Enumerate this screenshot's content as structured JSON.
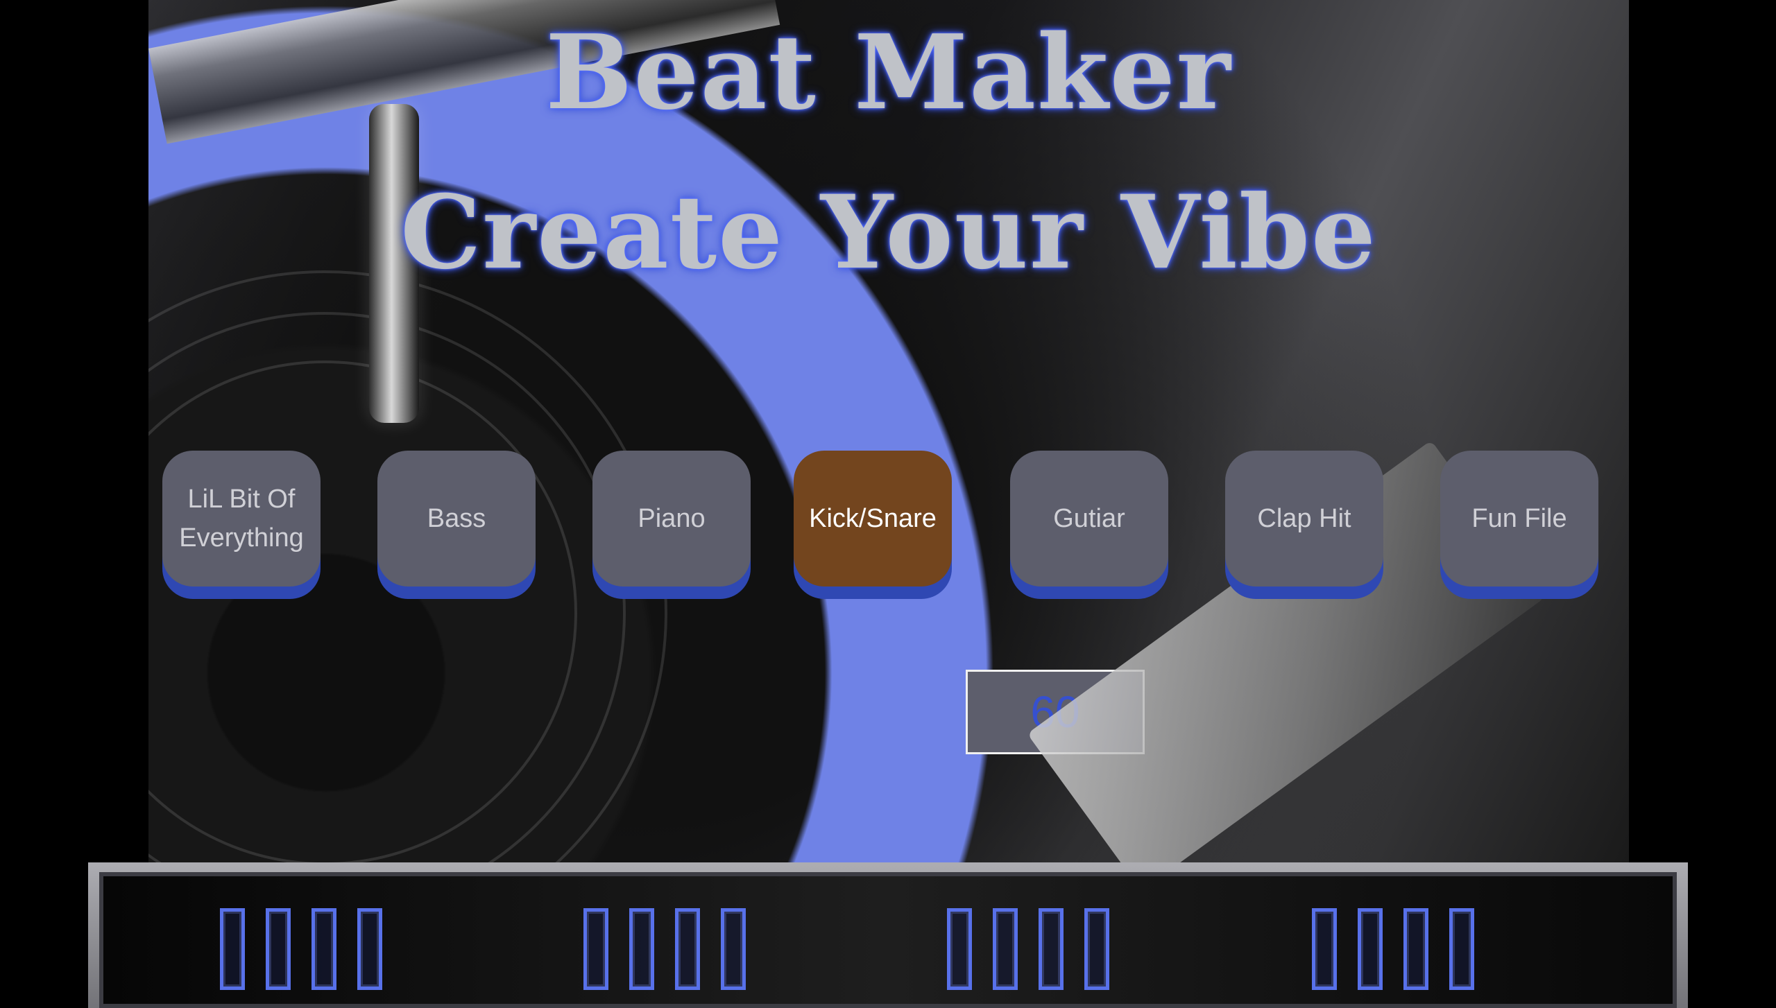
{
  "app": {
    "title_line_1": "Beat Maker",
    "title_line_2": "Create Your Vibe"
  },
  "pads": [
    {
      "label": "LiL Bit Of Everything",
      "active": false
    },
    {
      "label": "Bass",
      "active": false
    },
    {
      "label": "Piano",
      "active": false
    },
    {
      "label": "Kick/Snare",
      "active": true
    },
    {
      "label": "Gutiar",
      "active": false
    },
    {
      "label": "Clap Hit",
      "active": false
    },
    {
      "label": "Fun File",
      "active": false
    }
  ],
  "tempo": {
    "value": "60"
  },
  "sequencer": {
    "groups": 4,
    "steps_per_group": 4
  },
  "colors": {
    "pad_default": "#5d5e6c",
    "pad_active": "#73451e",
    "pad_accent": "#2f48b3",
    "title_glow": "#4562ff",
    "step_outline": "#5871ea"
  }
}
